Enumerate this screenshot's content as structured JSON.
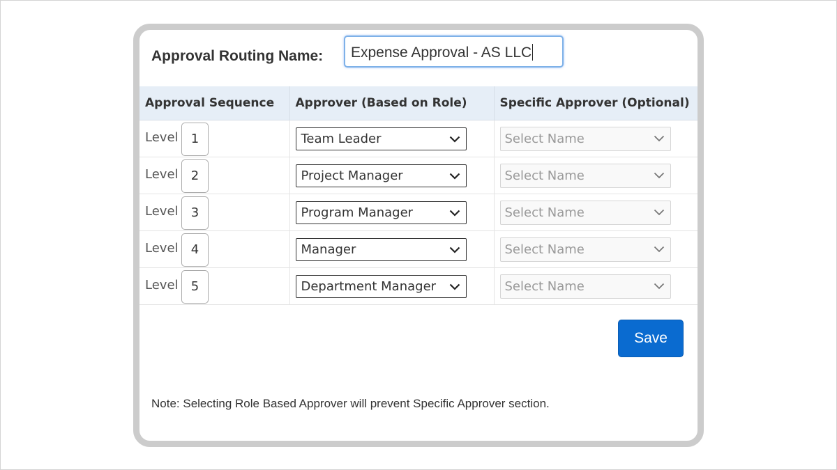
{
  "form": {
    "routing_name_label": "Approval Routing Name:",
    "routing_name_value": "Expense Approval - AS LLC"
  },
  "table": {
    "headers": [
      "Approval Sequence",
      "Approver (Based on Role)",
      "Specific Approver (Optional)"
    ],
    "rows": [
      {
        "level_label": "Level",
        "level": "1",
        "role": "Team Leader",
        "specific": "Select Name"
      },
      {
        "level_label": "Level",
        "level": "2",
        "role": "Project Manager",
        "specific": "Select Name"
      },
      {
        "level_label": "Level",
        "level": "3",
        "role": "Program Manager",
        "specific": "Select Name"
      },
      {
        "level_label": "Level",
        "level": "4",
        "role": "Manager",
        "specific": "Select Name"
      },
      {
        "level_label": "Level",
        "level": "5",
        "role": "Department Manager",
        "specific": "Select Name"
      }
    ]
  },
  "actions": {
    "save_label": "Save"
  },
  "note": "Note: Selecting Role Based Approver will prevent Specific Approver section.",
  "colors": {
    "accent": "#0a6bd0",
    "header_bg": "#e6eef7",
    "panel_border": "#cccccc",
    "disabled_text": "#999999"
  },
  "icons": {
    "dropdown": "chevron-down-icon"
  }
}
